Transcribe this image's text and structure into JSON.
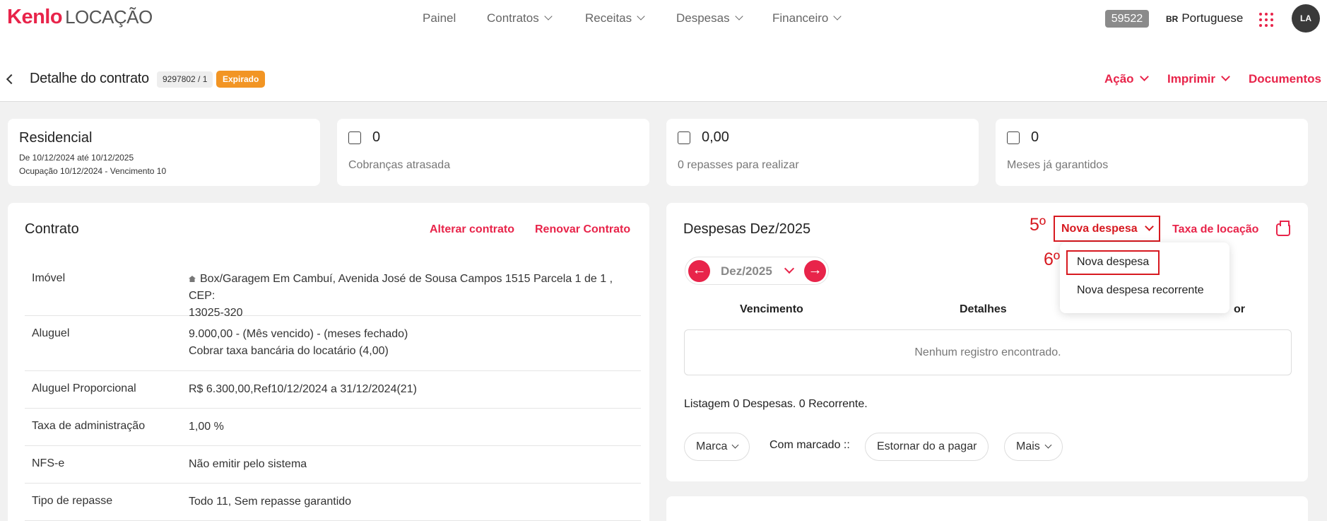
{
  "brand": {
    "part1": "Kenlo",
    "part2": "LOCAÇÃO"
  },
  "nav": [
    {
      "label": "Painel",
      "has_menu": false
    },
    {
      "label": "Contratos",
      "has_menu": true
    },
    {
      "label": "Receitas",
      "has_menu": true
    },
    {
      "label": "Despesas",
      "has_menu": true
    },
    {
      "label": "Financeiro",
      "has_menu": true
    }
  ],
  "header_right": {
    "count_badge": "59522",
    "lang_flag": "BR",
    "lang_label": "Portuguese",
    "avatar": "LA"
  },
  "page": {
    "title": "Detalhe do contrato",
    "contract_id": "9297802 / 1",
    "status": "Expirado",
    "actions": [
      "Ação",
      "Imprimir",
      "Documentos"
    ]
  },
  "summary": {
    "type_title": "Residencial",
    "period": "De 10/12/2024 até 10/12/2025",
    "occupancy": "Ocupação 10/12/2024 - Vencimento 10",
    "cards": [
      {
        "icon": "overdue-icon",
        "value": "0",
        "label": "Cobranças atrasada"
      },
      {
        "icon": "transfer-icon",
        "value": "0,00",
        "label": "0 repasses para realizar"
      },
      {
        "icon": "calendar-icon",
        "value": "0",
        "label": "Meses já garantidos"
      }
    ]
  },
  "contract": {
    "title": "Contrato",
    "links": [
      "Alterar contrato",
      "Renovar Contrato"
    ],
    "rows": [
      {
        "label": "Imóvel",
        "value1": "Box/Garagem Em Cambuí, Avenida José de Sousa Campos 1515 Parcela 1 de 1 , CEP:",
        "value2": "13025-320"
      },
      {
        "label": "Aluguel",
        "value1": "9.000,00 - (Mês vencido) - (meses fechado)",
        "value2": "Cobrar taxa bancária do locatário (4,00)"
      },
      {
        "label": "Aluguel Proporcional",
        "value1": "R$ 6.300,00,Ref10/12/2024 a 31/12/2024(21)",
        "value2": ""
      },
      {
        "label": "Taxa de administração",
        "value1": "1,00 %",
        "value2": ""
      },
      {
        "label": "NFS-e",
        "value1": "Não emitir pelo sistema",
        "value2": ""
      },
      {
        "label": "Tipo de repasse",
        "value1": "Todo 11, Sem repasse garantido",
        "value2": ""
      }
    ]
  },
  "expenses": {
    "title": "Despesas Dez/2025",
    "nova_despesa": "Nova despesa",
    "taxa_locacao": "Taxa de locação",
    "step5": "5º",
    "step6": "6º",
    "month": "Dez/2025",
    "columns": [
      "Vencimento",
      "Detalhes",
      "or"
    ],
    "empty": "Nenhum registro encontrado.",
    "listing": "Listagem 0 Despesas. 0 Recorrente.",
    "marca": "Marca",
    "com_marcado": "Com marcado ::",
    "estornar": "Estornar do a pagar",
    "mais": "Mais",
    "dropdown": [
      "Nova despesa",
      "Nova despesa recorrente"
    ]
  },
  "colors": {
    "accent": "#e8244a",
    "highlight": "#d71920",
    "status": "#f29524"
  }
}
